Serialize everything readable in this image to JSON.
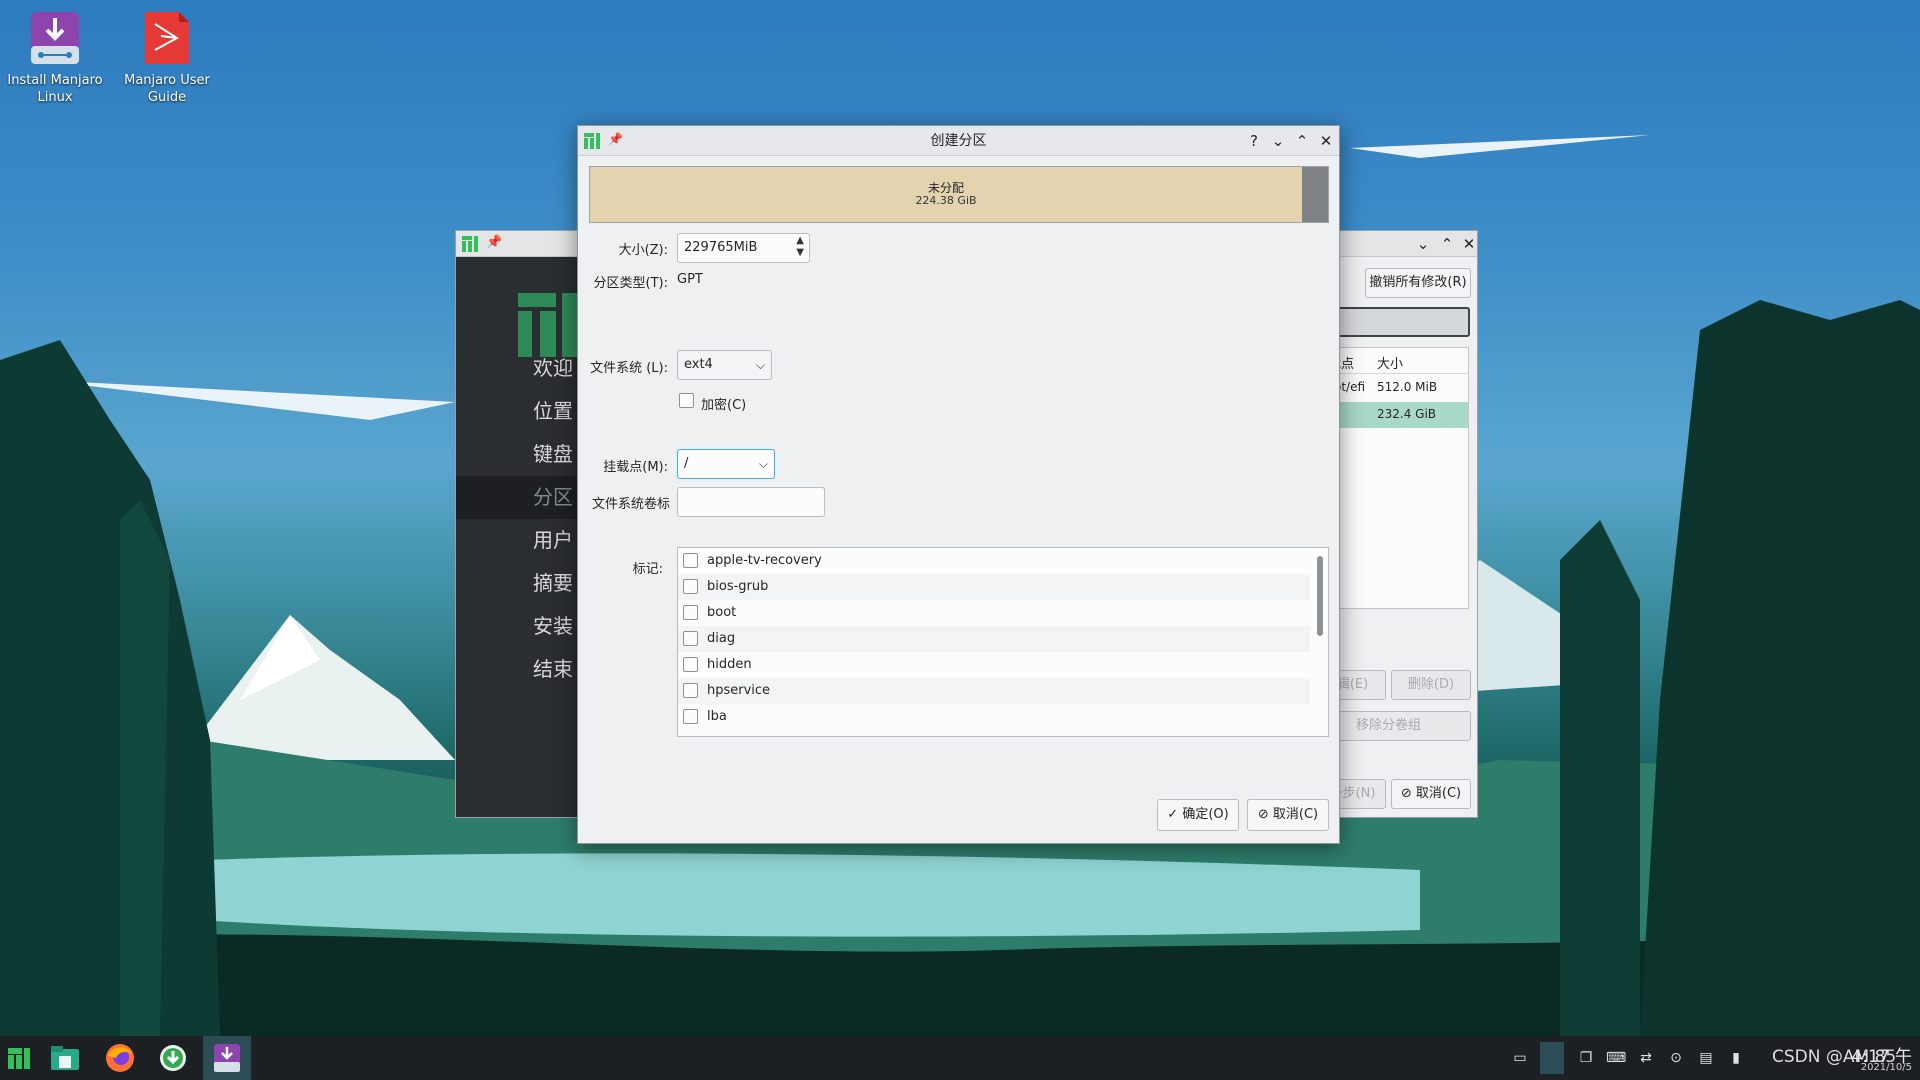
{
  "desktop": {
    "icons": [
      {
        "label": "Install Manjaro Linux"
      },
      {
        "label": "Manjaro User Guide"
      }
    ]
  },
  "background_window": {
    "sidebar": [
      "欢迎",
      "位置",
      "键盘",
      "分区",
      "用户",
      "摘要",
      "安装",
      "结束"
    ],
    "active_index": 3,
    "revert_button": "撤销所有修改(R)",
    "table_headers": [
      "挂载点",
      "大小"
    ],
    "rows": [
      {
        "mount": "/boot/efi",
        "size": "512.0 MiB"
      },
      {
        "mount": "",
        "size": "232.4 GiB"
      }
    ],
    "edit_button": "编辑(E)",
    "delete_button": "删除(D)",
    "remove_vg_button": "移除分卷组",
    "next_button": "下一步(N)",
    "cancel_button": "取消(C)"
  },
  "dialog": {
    "title": "创建分区",
    "help_icon": "?",
    "bar": {
      "title": "未分配",
      "size": "224.38 GiB"
    },
    "size_label": "大小(Z):",
    "size_value": "229765MiB",
    "ptype_label": "分区类型(T):",
    "ptype_value": "GPT",
    "fs_label": "文件系统 (L):",
    "fs_value": "ext4",
    "encrypt_label": "加密(C)",
    "mount_label": "挂载点(M):",
    "mount_value": "/",
    "fslabel_label": "文件系统卷标",
    "fslabel_value": "",
    "flags_label": "标记:",
    "flags": [
      "apple-tv-recovery",
      "bios-grub",
      "boot",
      "diag",
      "hidden",
      "hpservice",
      "lba"
    ],
    "ok_button": "确定(O)",
    "cancel_button": "取消(C)"
  },
  "taskbar": {
    "clock": "4:17 午",
    "date": "2021/10/5",
    "watermark": "CSDN @AM 85"
  },
  "colors": {
    "accent": "#3daee9",
    "unallocated": "#e3d3ae",
    "sidebar": "#2b2e31",
    "selected_row": "#a8d8c8"
  }
}
